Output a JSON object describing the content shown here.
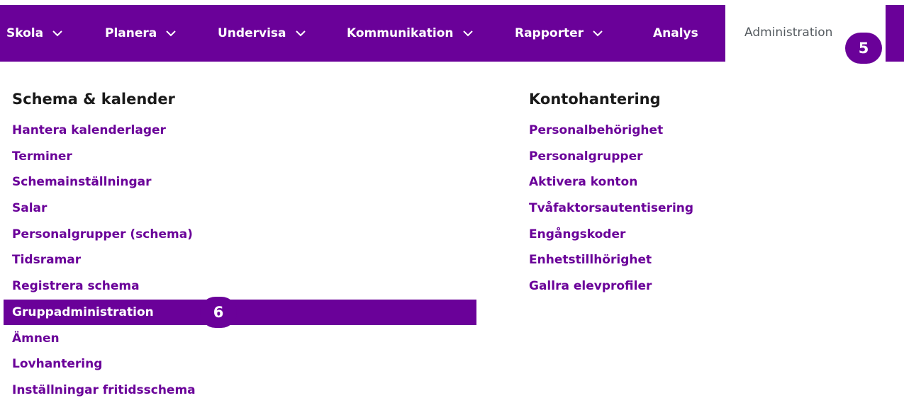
{
  "nav": {
    "items": [
      {
        "label": "Skola",
        "dropdown": true
      },
      {
        "label": "Planera",
        "dropdown": true
      },
      {
        "label": "Undervisa",
        "dropdown": true
      },
      {
        "label": "Kommunikation",
        "dropdown": true
      },
      {
        "label": "Rapporter",
        "dropdown": true
      },
      {
        "label": "Analys",
        "dropdown": false
      }
    ],
    "active_tab": "Administration",
    "badge_active_tab": "5"
  },
  "columns": [
    {
      "heading": "Schema & kalender",
      "links": [
        "Hantera kalenderlager",
        "Terminer",
        "Schemainställningar",
        "Salar",
        "Personalgrupper (schema)",
        "Tidsramar",
        "Registrera schema",
        "Gruppadministration",
        "Ämnen",
        "Lovhantering",
        "Inställningar fritidsschema"
      ]
    },
    {
      "heading": "Kontohantering",
      "links": [
        "Personalbehörighet",
        "Personalgrupper",
        "Aktivera konton",
        "Tvåfaktorsautentisering",
        "Engångskoder",
        "Enhetstillhörighet",
        "Gallra elevprofiler"
      ]
    }
  ],
  "highlighted_link": "Gruppadministration",
  "badge_highlighted_link": "6",
  "colors": {
    "brand_purple": "#6a0199",
    "text_dark": "#1a1a1a",
    "tab_text": "#555b60"
  },
  "icons": {
    "dropdown": "chevron-down-icon"
  }
}
